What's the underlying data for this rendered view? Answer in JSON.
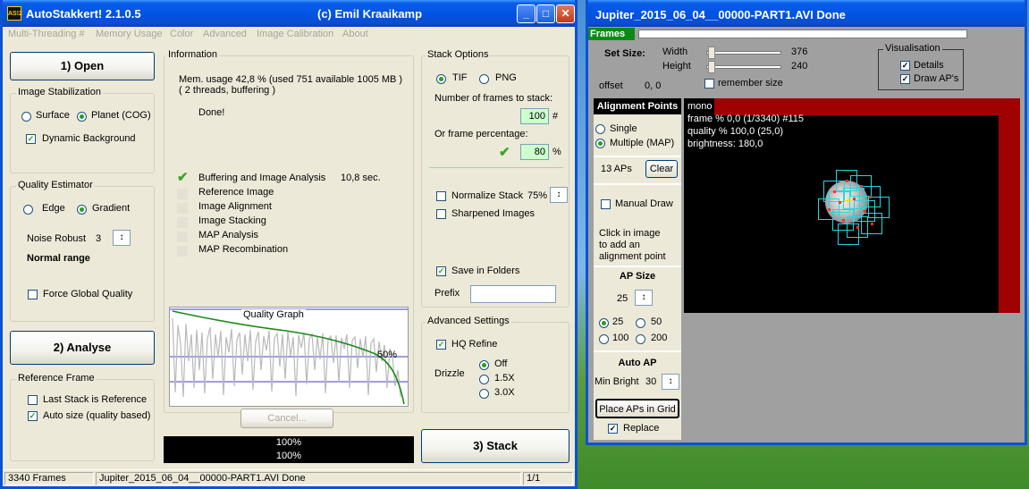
{
  "left_window": {
    "title": "AutoStakkert! 2.1.0.5",
    "author": "(c) Emil Kraaikamp",
    "menu": [
      "Multi-Threading #",
      "Memory Usage",
      "Color",
      "Advanced",
      "Image Calibration",
      "About"
    ],
    "open_button": "1) Open",
    "analyse_button": "2) Analyse",
    "stack_button": "3) Stack",
    "image_stabilization": {
      "title": "Image Stabilization",
      "surface": "Surface",
      "planet": "Planet (COG)",
      "dynamic_background": "Dynamic Background"
    },
    "quality_estimator": {
      "title": "Quality Estimator",
      "edge": "Edge",
      "gradient": "Gradient",
      "noise_robust_label": "Noise Robust",
      "noise_robust_value": "3",
      "range_text": "Normal range",
      "force_global": "Force Global Quality"
    },
    "reference_frame": {
      "title": "Reference Frame",
      "last_stack": "Last Stack is Reference",
      "auto_size": "Auto size (quality based)"
    },
    "information": {
      "title": "Information",
      "mem_line1": "Mem. usage 42,8 %  (used 751 available 1005 MB )",
      "mem_line2": "( 2 threads, buffering )",
      "done": "Done!",
      "steps": [
        {
          "label": "Buffering and Image Analysis",
          "time": "10,8 sec.",
          "done": true
        },
        {
          "label": "Reference Image",
          "time": "",
          "done": false
        },
        {
          "label": "Image Alignment",
          "time": "",
          "done": false
        },
        {
          "label": "Image Stacking",
          "time": "",
          "done": false
        },
        {
          "label": "MAP Analysis",
          "time": "",
          "done": false
        },
        {
          "label": "MAP Recombination",
          "time": "",
          "done": false
        }
      ]
    },
    "quality_graph": {
      "title": "Quality Graph",
      "percent_label": "50%"
    },
    "cancel_button": "Cancel...",
    "progress": [
      "100%",
      "100%"
    ],
    "stack_options": {
      "title": "Stack Options",
      "tif": "TIF",
      "png": "PNG",
      "frames_label": "Number of frames to stack:",
      "frames_value": "100",
      "frames_unit": "#",
      "pct_label": "Or frame percentage:",
      "pct_value": "80",
      "pct_unit": "%",
      "normalize": "Normalize Stack",
      "normalize_value": "75%",
      "sharpened": "Sharpened Images",
      "save_folders": "Save in Folders",
      "prefix": "Prefix",
      "prefix_value": ""
    },
    "advanced_settings": {
      "title": "Advanced Settings",
      "hq_refine": "HQ Refine",
      "drizzle": "Drizzle",
      "options": [
        "Off",
        "1.5X",
        "3.0X"
      ]
    },
    "status": {
      "frames": "3340 Frames",
      "file": "Jupiter_2015_06_04__00000-PART1.AVI   Done",
      "page": "1/1"
    }
  },
  "right_window": {
    "title": "Jupiter_2015_06_04__00000-PART1.AVI   Done",
    "frames_label": "Frames",
    "set_size": "Set Size:",
    "width_label": "Width",
    "width_value": "376",
    "height_label": "Height",
    "height_value": "240",
    "offset_label": "offset",
    "offset_value": "0, 0",
    "remember_size": "remember size",
    "visualisation": {
      "title": "Visualisation",
      "details": "Details",
      "draw_aps": "Draw AP's"
    },
    "alignment": {
      "header": "Alignment Points",
      "single": "Single",
      "multiple": "Multiple (MAP)",
      "ap_count": "13 APs",
      "clear": "Clear",
      "manual_draw": "Manual Draw",
      "hint": [
        "Click in image",
        "to add an",
        "alignment point"
      ],
      "ap_size_title": "AP Size",
      "ap_size_value": "25",
      "sizes": [
        "25",
        "50",
        "100",
        "200"
      ],
      "auto_ap": "Auto AP",
      "min_bright_label": "Min Bright",
      "min_bright_value": "30",
      "place_button": "Place APs in Grid",
      "replace": "Replace"
    },
    "preview": {
      "mode": "mono",
      "line1": "frame % 0,0 (1/3340) #115",
      "line2": "quality % 100,0  (25,0)",
      "line3": "brightness: 180,0"
    }
  }
}
